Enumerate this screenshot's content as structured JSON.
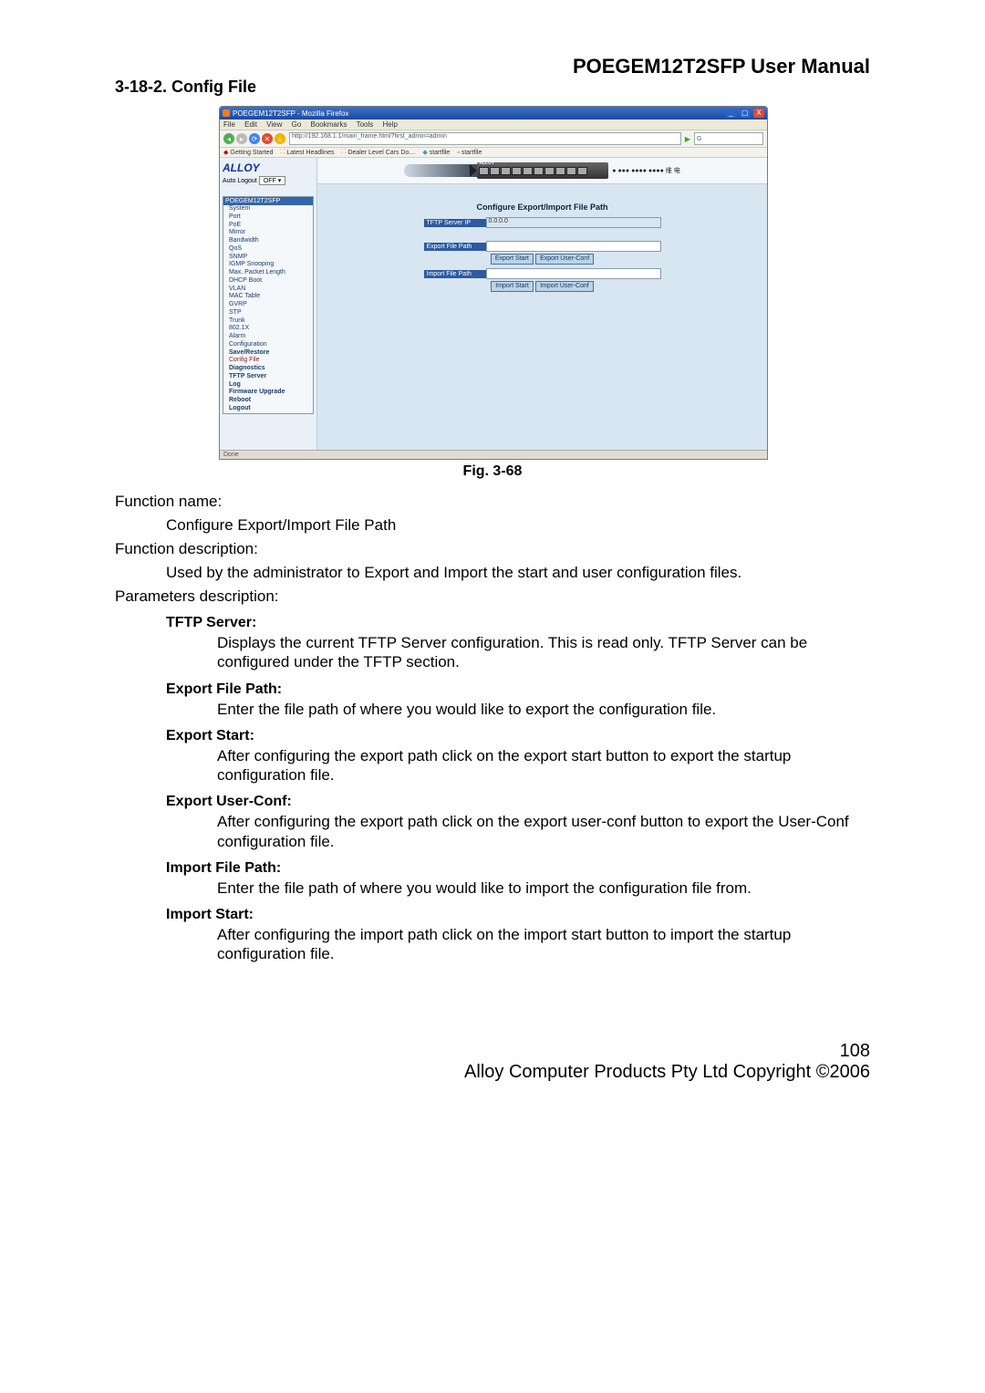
{
  "doc": {
    "product_title": "POEGEM12T2SFP User Manual",
    "section_number_title": "3-18-2. Config File",
    "figure_caption": "Fig. 3-68",
    "function_name_label": "Function name:",
    "function_name_value": "Configure Export/Import File Path",
    "function_desc_label": "Function description:",
    "function_desc_value": "Used by the administrator to Export and Import the start and user configuration files.",
    "params_label": "Parameters description:",
    "params": [
      {
        "label": "TFTP Server:",
        "desc": "Displays the current TFTP Server configuration. This is read only. TFTP Server can be configured under the TFTP section."
      },
      {
        "label": "Export File Path:",
        "desc": "Enter the file path of where you would like to export the configuration file."
      },
      {
        "label": "Export Start:",
        "desc": "After configuring the export path click on the export start button to export the startup configuration file."
      },
      {
        "label": "Export User-Conf:",
        "desc": "After configuring the export path click on the export user-conf button to export the User-Conf configuration file."
      },
      {
        "label": "Import File Path:",
        "desc": "Enter the file path of where you would like to import the configuration file from."
      },
      {
        "label": "Import Start:",
        "desc": "After configuring the import path click on the import start button to import the startup configuration file."
      }
    ],
    "page_number": "108",
    "copyright": "Alloy Computer Products Pty Ltd Copyright ©2006"
  },
  "fx": {
    "title": "POEGEM12T2SFP - Mozilla Firefox",
    "menus": [
      "File",
      "Edit",
      "View",
      "Go",
      "Bookmarks",
      "Tools",
      "Help"
    ],
    "url": "http://192.168.1.1/main_frame.html?first_admin=admin",
    "search_engine": "G",
    "bookmarks": [
      "Getting Started",
      "Latest Headlines",
      "Dealer Level Cars Do…",
      "startfile",
      "startfile"
    ],
    "logo": "ALLOY",
    "auto_logout_label": "Auto Logout",
    "auto_logout_value": "OFF",
    "menu_head": "POEGEM12T2SFP",
    "menu_items": [
      {
        "t": "System"
      },
      {
        "t": "Port"
      },
      {
        "t": "PoE"
      },
      {
        "t": "Mirror"
      },
      {
        "t": "Bandwidth"
      },
      {
        "t": "QoS"
      },
      {
        "t": "SNMP"
      },
      {
        "t": "IGMP Snooping"
      },
      {
        "t": "Max. Packet Length"
      },
      {
        "t": "DHCP Boot"
      },
      {
        "t": "VLAN"
      },
      {
        "t": "MAC Table"
      },
      {
        "t": "GVRP"
      },
      {
        "t": "STP"
      },
      {
        "t": "Trunk"
      },
      {
        "t": "802.1X"
      },
      {
        "t": "Alarm"
      },
      {
        "t": "Configuration"
      },
      {
        "t": "Save/Restore",
        "bold": true
      },
      {
        "t": "Config File",
        "hl": true
      },
      {
        "t": "Diagnostics",
        "bold": true
      },
      {
        "t": "TFTP Server",
        "bold": true
      },
      {
        "t": "Log",
        "bold": true
      },
      {
        "t": "Firmware Upgrade",
        "bold": true
      },
      {
        "t": "Reboot",
        "bold": true
      },
      {
        "t": "Logout",
        "bold": true
      }
    ],
    "device_label": "● ●●● ●●●● ●●●● 维 电",
    "cfg_title": "Configure Export/Import File Path",
    "tftp_label": "TFTP Server IP",
    "tftp_value": "0.0.0.0",
    "export_label": "Export File Path",
    "export_value": "",
    "export_start_btn": "Export Start",
    "export_user_btn": "Export User-Conf",
    "import_label": "Import File Path",
    "import_value": "",
    "import_start_btn": "Import Start",
    "import_user_btn": "Import User-Conf",
    "status": "Done"
  }
}
